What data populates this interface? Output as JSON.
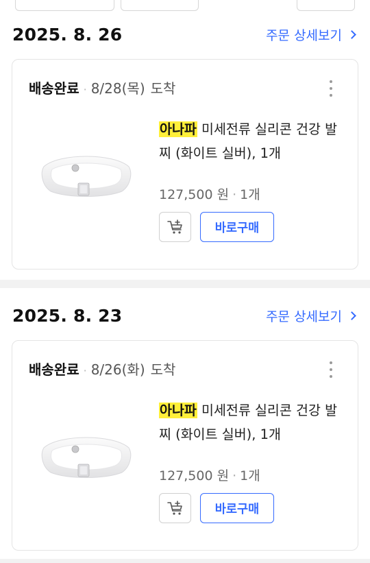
{
  "orders": [
    {
      "date": "2025. 8. 26",
      "detail_link": "주문 상세보기",
      "status": "배송완료",
      "arrival_date": "8/28(목)",
      "arrival_label": "도착",
      "brand": "아나파",
      "product_name": " 미세전류 실리콘 건강 발찌 (화이트 실버), 1개",
      "price": "127,500 원",
      "quantity": "1개",
      "buy_again_label": "바로구매"
    },
    {
      "date": "2025. 8. 23",
      "detail_link": "주문 상세보기",
      "status": "배송완료",
      "arrival_date": "8/26(화)",
      "arrival_label": "도착",
      "brand": "아나파",
      "product_name": " 미세전류 실리콘 건강 발찌 (화이트 실버), 1개",
      "price": "127,500 원",
      "quantity": "1개",
      "buy_again_label": "바로구매"
    }
  ],
  "colors": {
    "accent": "#346aff",
    "highlight": "#ffef3a",
    "divider": "#f2f2f2"
  },
  "icons": {
    "more": "more-vertical-icon",
    "cart": "add-to-cart-icon",
    "chevron": "chevron-right-icon"
  }
}
